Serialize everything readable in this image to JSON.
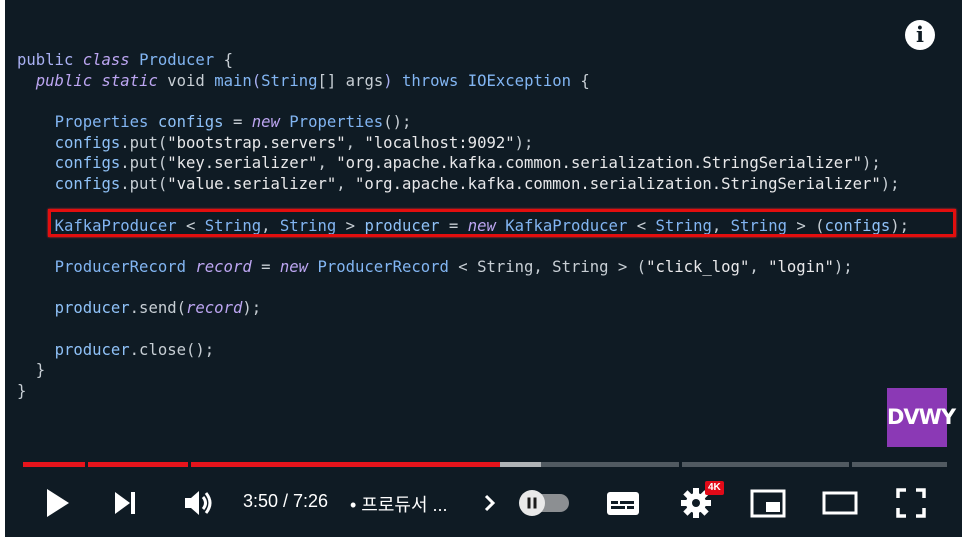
{
  "info_icon": {
    "glyph": "i",
    "name": "info-icon"
  },
  "code": {
    "l1": {
      "a": "public",
      "b": "class",
      "c": "Producer",
      "d": " {"
    },
    "l2": {
      "a": "public",
      "b": "static",
      "c": "void",
      "d": "main",
      "e": "(",
      "f": "String",
      "g": "[] args",
      "h": ")",
      "i": "throws",
      "j": "IOException",
      "k": " {"
    },
    "l4": {
      "a": "Properties",
      "b": "configs",
      "c": " = ",
      "d": "new",
      "e": "Properties",
      "f": "();"
    },
    "l5": {
      "a": "configs",
      "b": ".put(",
      "c": "\"bootstrap.servers\"",
      "d": ", ",
      "e": "\"localhost:9092\"",
      "f": ");"
    },
    "l6": {
      "a": "configs",
      "b": ".put(",
      "c": "\"key.serializer\"",
      "d": ", ",
      "e": "\"org.apache.kafka.common.serialization.StringSerializer\"",
      "f": ");"
    },
    "l7": {
      "a": "configs",
      "b": ".put(",
      "c": "\"value.serializer\"",
      "d": ", ",
      "e": "\"org.apache.kafka.common.serialization.StringSerializer\"",
      "f": ");"
    },
    "l9": {
      "a": "KafkaProducer",
      "b": " < ",
      "c": "String",
      "d": ", ",
      "e": "String",
      "f": " > ",
      "g": "producer",
      "h": " = ",
      "i": "new",
      "j": "KafkaProducer",
      "k": " < ",
      "l": "String",
      "m": ", ",
      "n": "String",
      "o": " > (",
      "p": "configs",
      "q": ");"
    },
    "l11": {
      "a": "ProducerRecord",
      "b": "record",
      "c": " = ",
      "d": "new",
      "e": "ProducerRecord",
      "f": " < String, String > (",
      "g": "\"click_log\"",
      "h": ", ",
      "i": "\"login\"",
      "j": ");"
    },
    "l13": {
      "a": "producer",
      "b": ".send(",
      "c": "record",
      "d": ");"
    },
    "l15": {
      "a": "producer",
      "b": ".close",
      "c": "();"
    },
    "l16": {
      "a": "}"
    },
    "l17": {
      "a": "}"
    }
  },
  "logo": {
    "text": "DVWY"
  },
  "progress": {
    "played_fraction": 0.516,
    "buffered_fraction": 0.561,
    "accent": "#e6141c"
  },
  "controls": {
    "time": "3:50 / 7:26",
    "chapter": "• 프로듀서 ...",
    "chapter_chevron": "›",
    "settings_badge": "4K"
  },
  "colors": {
    "background": "#0f1b24",
    "highlight_box": "#e30e0e",
    "logo": "#8b39b5"
  }
}
